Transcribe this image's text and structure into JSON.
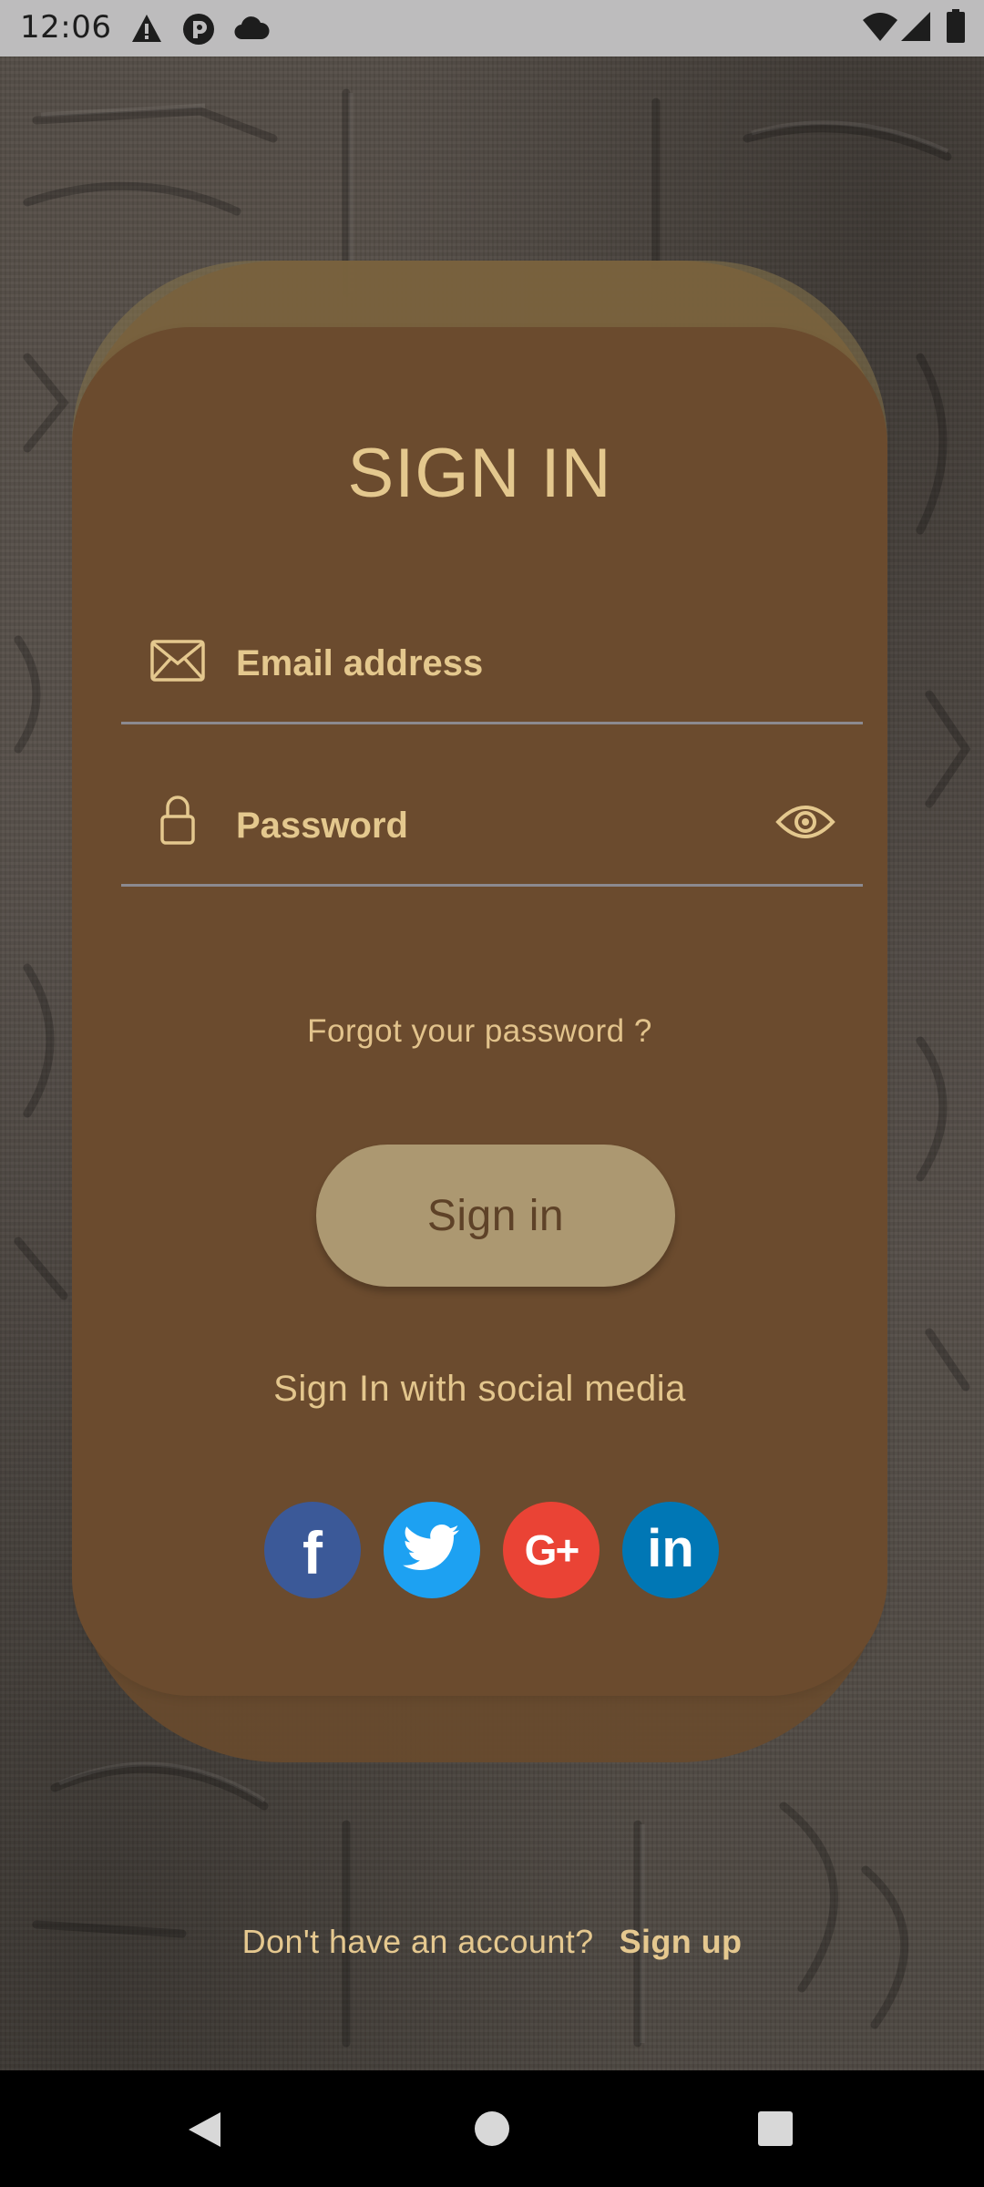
{
  "status_bar": {
    "time": "12:06",
    "icons": [
      "alert-icon",
      "app-icon",
      "cloud-icon",
      "wifi-icon",
      "signal-icon",
      "battery-icon"
    ]
  },
  "login": {
    "title": "SIGN IN",
    "email": {
      "placeholder": "Email address",
      "icon": "mail-icon"
    },
    "password": {
      "placeholder": "Password",
      "icon": "lock-icon",
      "toggle_icon": "eye-icon"
    },
    "forgot_password": "Forgot your password ?",
    "sign_in_button": "Sign in",
    "social_heading": "Sign In with social media",
    "social": [
      {
        "name": "facebook",
        "icon": "facebook-icon",
        "glyph": "f",
        "color": "#3b5998"
      },
      {
        "name": "twitter",
        "icon": "twitter-icon",
        "glyph": "",
        "color": "#1da1f2"
      },
      {
        "name": "google-plus",
        "icon": "google-plus-icon",
        "glyph": "G+",
        "color": "#ea4335"
      },
      {
        "name": "linkedin",
        "icon": "linkedin-icon",
        "glyph": "in",
        "color": "#0077b5"
      }
    ]
  },
  "footer": {
    "question": "Don't have an account?",
    "sign_up_link": "Sign up"
  },
  "nav_bar": {
    "buttons": [
      "back-icon",
      "home-icon",
      "recents-icon"
    ]
  },
  "colors": {
    "accent_text": "#e4c88e",
    "card": "#6b4b2e",
    "button": "#ac9871",
    "status_bar": "#bdbcbd"
  }
}
